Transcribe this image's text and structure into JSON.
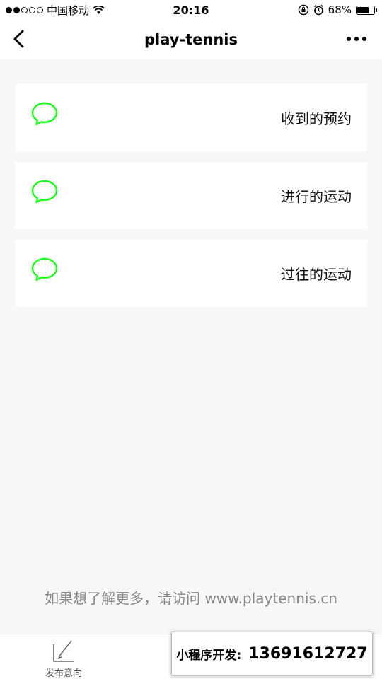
{
  "status_bar": {
    "carrier": "中国移动",
    "time": "20:16",
    "battery": "68%",
    "battery_level": 0.68,
    "signal_filled": 2,
    "signal_total": 5
  },
  "nav": {
    "title": "play-tennis"
  },
  "menu": {
    "items": [
      {
        "label": "收到的预约",
        "icon": "chat-bubble-icon"
      },
      {
        "label": "进行的运动",
        "icon": "chat-bubble-icon"
      },
      {
        "label": "过往的运动",
        "icon": "chat-bubble-icon"
      }
    ],
    "icon_color": "#1aff1a"
  },
  "footer": {
    "text": "如果想了解更多，请访问 www.playtennis.cn"
  },
  "tab_bar": {
    "items": [
      {
        "label": "发布意向",
        "icon": "edit-pen-icon"
      }
    ]
  },
  "promo": {
    "label": "小程序开发:",
    "phone": "13691612727"
  }
}
